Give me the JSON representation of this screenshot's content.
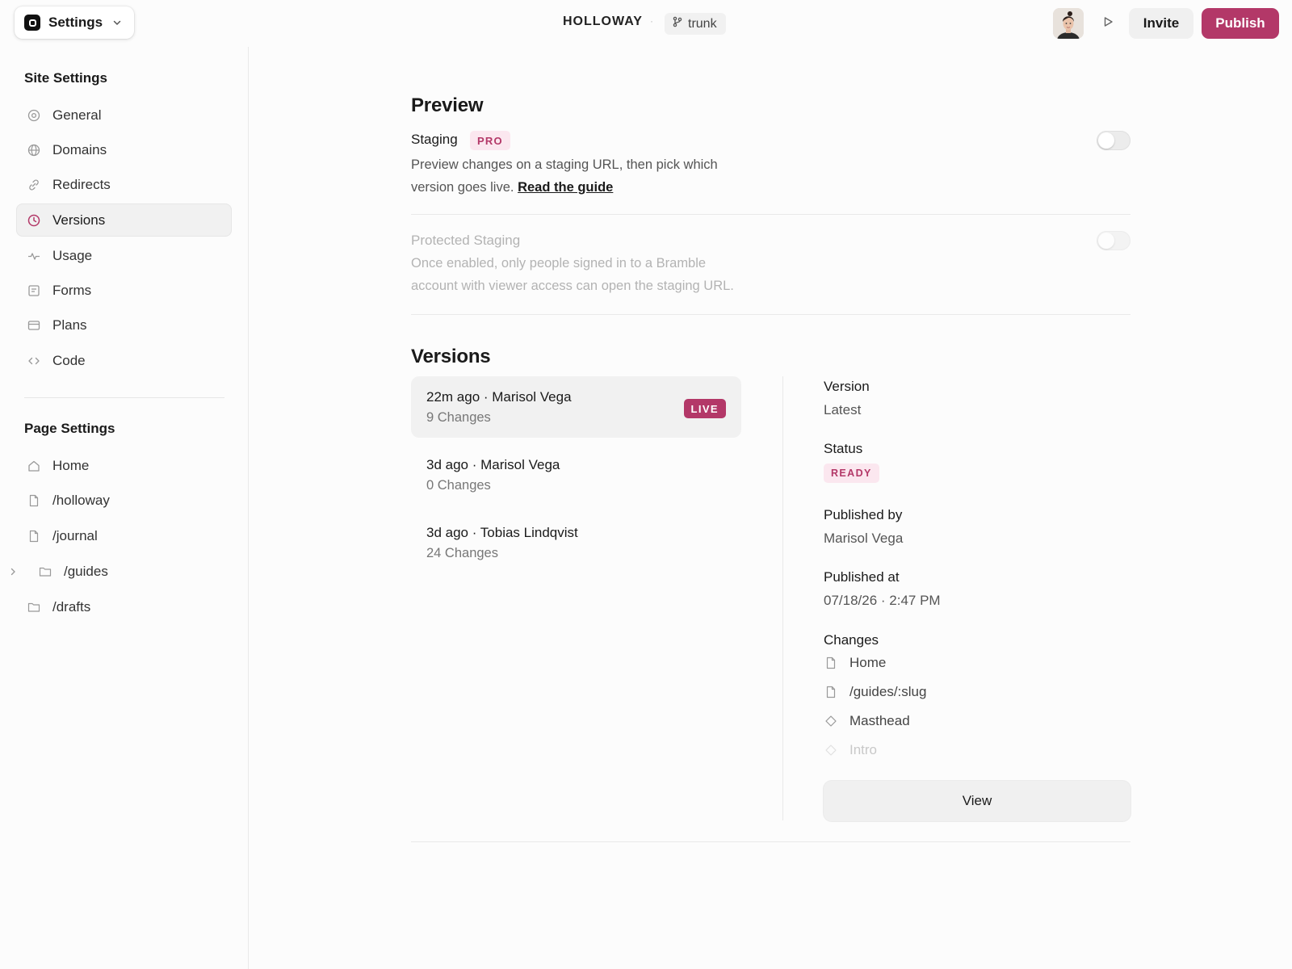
{
  "header": {
    "menu_label": "Settings",
    "project_name": "HOLLOWAY",
    "separator": "·",
    "branch": "trunk",
    "invite_label": "Invite",
    "publish_label": "Publish"
  },
  "sidebar": {
    "site_title": "Site Settings",
    "site_items": [
      {
        "label": "General",
        "icon": "general-icon"
      },
      {
        "label": "Domains",
        "icon": "globe-icon"
      },
      {
        "label": "Redirects",
        "icon": "link-icon"
      },
      {
        "label": "Versions",
        "icon": "clock-icon",
        "active": true
      },
      {
        "label": "Usage",
        "icon": "activity-icon"
      },
      {
        "label": "Forms",
        "icon": "form-icon"
      },
      {
        "label": "Plans",
        "icon": "card-icon"
      },
      {
        "label": "Code",
        "icon": "code-icon"
      }
    ],
    "page_title": "Page Settings",
    "page_items": [
      {
        "label": "Home",
        "icon": "home-icon"
      },
      {
        "label": "/holloway",
        "icon": "page-icon"
      },
      {
        "label": "/journal",
        "icon": "page-icon"
      },
      {
        "label": "/guides",
        "icon": "folder-icon"
      },
      {
        "label": "/drafts",
        "icon": "folder-icon"
      }
    ]
  },
  "preview": {
    "heading": "Preview",
    "staging_label": "Staging",
    "pro_badge": "PRO",
    "staging_desc_line1": "Preview changes on a staging URL, then pick which",
    "staging_desc_line2": "version goes live.",
    "guide_link": "Read the guide",
    "staging_enabled": false,
    "protected_label": "Protected Staging",
    "protected_desc_line1": "Once enabled, only people signed in to a Bramble",
    "protected_desc_line2": "account with viewer access can open the staging URL.",
    "protected_enabled": false
  },
  "versions": {
    "heading": "Versions",
    "list": [
      {
        "title": "22m ago · Marisol Vega",
        "changes": "9 Changes",
        "badge": "LIVE"
      },
      {
        "title": "3d ago · Marisol Vega",
        "changes": "0 Changes"
      },
      {
        "title": "3d ago · Tobias Lindqvist",
        "changes": "24 Changes"
      }
    ],
    "detail": {
      "version_label": "Version",
      "version_value": "Latest",
      "status_label": "Status",
      "status_value": "READY",
      "published_by_label": "Published by",
      "published_by_value": "Marisol Vega",
      "published_at_label": "Published at",
      "published_at_value": "07/18/26 · 2:47 PM",
      "changes_label": "Changes",
      "changes": [
        {
          "label": "Home",
          "icon": "page-icon"
        },
        {
          "label": "/guides/:slug",
          "icon": "page-icon"
        },
        {
          "label": "Masthead",
          "icon": "component-icon"
        },
        {
          "label": "Intro",
          "icon": "component-icon"
        }
      ],
      "view_label": "View"
    }
  },
  "colors": {
    "accent": "#b33868",
    "accent_soft": "#fbe7ef"
  }
}
